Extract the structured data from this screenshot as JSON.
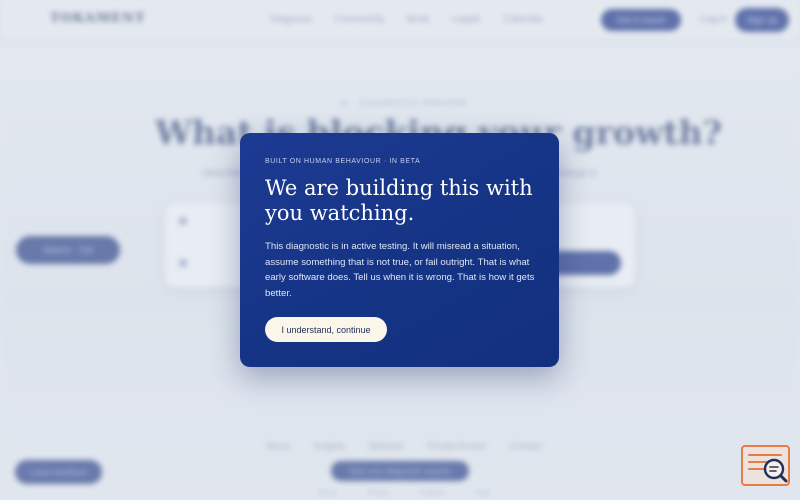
{
  "background": {
    "logo": "TOKAMENT",
    "nav_links": [
      "Diagnose",
      "Community",
      "Book",
      "Legals",
      "Calendar"
    ],
    "nav_cta": "Get in touch",
    "nav_login": "Log in",
    "nav_signup": "Sign up",
    "eyebrow": "AI · DIAGNOSTIC PREVIEW",
    "headline": "What is blocking your growth?",
    "subline_left": "Describe",
    "subline_right": "change it.",
    "side_pill": "Search · Ctrl",
    "footer_links": [
      "About",
      "Insights",
      "Methods",
      "Private Access",
      "Contact"
    ],
    "bottom_left_pill": "Leave feedback",
    "bottom_center_pill": "Start your diagnostic session",
    "legal_links": [
      "Terms",
      "Privacy",
      "Cookies",
      "Help"
    ]
  },
  "modal": {
    "eyebrow": "BUILT ON HUMAN BEHAVIOUR · IN BETA",
    "title": "We are building this with you watching.",
    "body": "This diagnostic is in active testing. It will misread a situation, assume something that is not true, or fail outright. That is what early software does. Tell us when it is wrong. That is how it gets better.",
    "button": "I understand, continue"
  },
  "widget": {
    "icon": "search-list-icon"
  },
  "colors": {
    "modal_bg": "#1a3889",
    "button_bg": "#fbf6ea",
    "accent_widget": "#e87b4a"
  }
}
